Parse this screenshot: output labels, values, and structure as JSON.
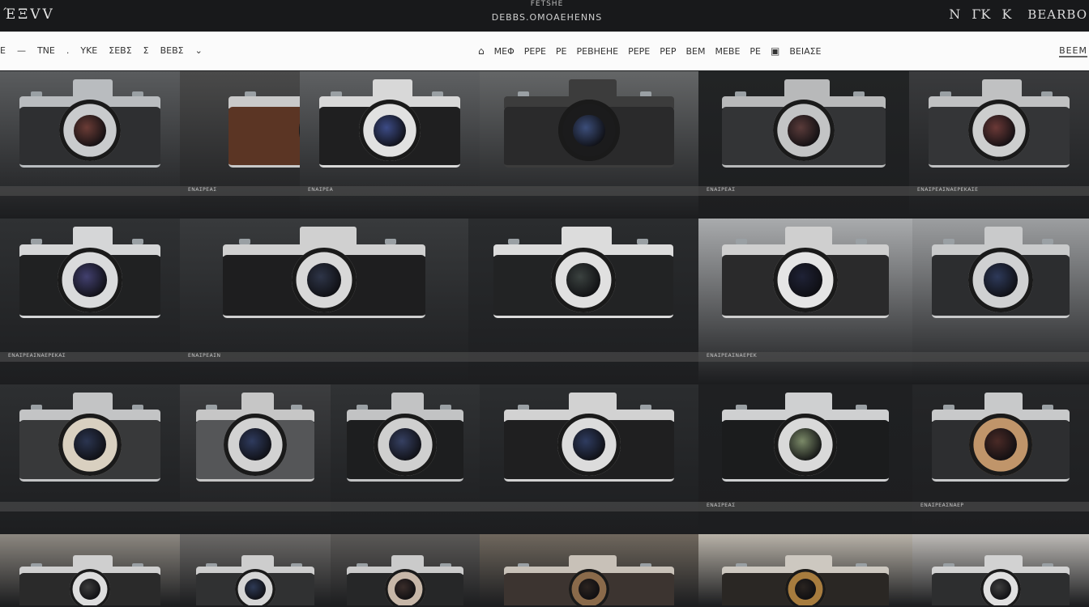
{
  "header": {
    "brand": "ΈΞVV",
    "title": "FETSHE",
    "subtitle": "DEBBS.OMOAEHENNS",
    "right_glyphs": [
      "Ν",
      "ΓΚ",
      "Κ"
    ],
    "account_label": "BEARBO"
  },
  "toolbar": {
    "nav": [
      "Ε",
      "—",
      "ΤΝΕ",
      ".",
      "ΥΚΕ",
      "ΣΕΒΣ",
      "Σ",
      "ΒΕΒΣ",
      "⌄"
    ],
    "mid_icon": "gift-icon",
    "mid_items": [
      "ΜΕΦ",
      "ΡΕΡΕ",
      "ΡΕ",
      "ΡΕΒΗΕΗΕ",
      "ΡΕΡΕ",
      "ΡΕΡ",
      "ΒΕΜ",
      "ΜΕΒΕ",
      "ΡΕ"
    ],
    "tag_icon": "tag-icon",
    "tag_label": "ΒΕΙΑΣΕ",
    "sort_label": "ΒΕΕΜ"
  },
  "grid": {
    "rows": [
      {
        "tiles": [
          {
            "caption": "",
            "bg": "#5a5c5e",
            "cam": {
              "body": "#2e2f31",
              "trim": "#b9bcbf",
              "lens": "#c9cbcd",
              "glass": "#6b3c36"
            }
          },
          {
            "caption": "ΕΝΑΣΡΕΑΣ",
            "bg": "#4a4a4a",
            "cam": {
              "body": "#5b3524",
              "trim": "#c9c9c9",
              "lens": "#2a2a2a",
              "glass": "#3a3a3a"
            }
          },
          {
            "caption": "ΕΝΑΣΡΕΑ",
            "bg": "#5f6163",
            "cam": {
              "body": "#1f1f20",
              "trim": "#d8d8d8",
              "lens": "#e1e1e1",
              "glass": "#3c4b86"
            }
          },
          {
            "caption": "",
            "bg": "#646667",
            "cam": {
              "body": "#2a2a2b",
              "trim": "#3c3c3c",
              "lens": "#1b1b1c",
              "glass": "#3c4e7a"
            }
          },
          {
            "caption": "ΕΝΑΣΡΕΑΣ",
            "bg": "#222425",
            "cam": {
              "body": "#333436",
              "trim": "#b8b9ba",
              "lens": "#c3c4c5",
              "glass": "#5a3b3a"
            }
          },
          {
            "caption": "ΕΝΑΣΡΕΑΣΝΑΕΡΕΚΑΣΕ",
            "bg": "#3a3b3d",
            "cam": {
              "body": "#343537",
              "trim": "#c0c1c2",
              "lens": "#cdcece",
              "glass": "#6b3937"
            }
          }
        ]
      },
      {
        "tiles": [
          {
            "caption": "ΕΝΑΣΡΕΑΣΝΑΕΡΕΚΑΣ",
            "bg": "#2f3133",
            "cam": {
              "body": "#202122",
              "trim": "#d5d6d7",
              "lens": "#dadbdc",
              "glass": "#42406f"
            }
          },
          {
            "caption": "ΕΝΑΣΡΕΑΣΝ",
            "bg": "#383a3c",
            "cam": {
              "body": "#1e1e1f",
              "trim": "#d0d0d0",
              "lens": "#d8d8d8",
              "glass": "#2e3548"
            }
          },
          {
            "caption": "",
            "bg": "#2a2c2e",
            "cam": {
              "body": "#222324",
              "trim": "#dcdcdc",
              "lens": "#e0e0e0",
              "glass": "#3b4240"
            }
          },
          {
            "caption": "ΕΝΑΣΡΕΑΣΝΑΕΡΕΚ",
            "bg": "#a9abad",
            "cam": {
              "body": "#2a2a2b",
              "trim": "#cfcfcf",
              "lens": "#e5e5e5",
              "glass": "#1f2236"
            }
          },
          {
            "caption": "",
            "bg": "#9c9ea0",
            "cam": {
              "body": "#2c2d2f",
              "trim": "#c9cacb",
              "lens": "#d0d1d2",
              "glass": "#2e3a5a"
            }
          }
        ]
      },
      {
        "tiles": [
          {
            "caption": "",
            "bg": "#2d2f31",
            "cam": {
              "body": "#38393a",
              "trim": "#c3c4c5",
              "lens": "#d9d0c0",
              "glass": "#2b3550"
            }
          },
          {
            "caption": "",
            "bg": "#3c3d3f",
            "cam": {
              "body": "#555658",
              "trim": "#c6c6c6",
              "lens": "#d2d2d2",
              "glass": "#2f3b5e"
            }
          },
          {
            "caption": "",
            "bg": "#303234",
            "cam": {
              "body": "#1d1e1f",
              "trim": "#c2c3c4",
              "lens": "#cfcfcf",
              "glass": "#364062"
            }
          },
          {
            "caption": "",
            "bg": "#2b2d2f",
            "cam": {
              "body": "#1f1f20",
              "trim": "#d2d2d2",
              "lens": "#dcdcdc",
              "glass": "#2f3c60"
            }
          },
          {
            "caption": "ΕΝΑΣΡΕΑΣ",
            "bg": "#1f2022",
            "cam": {
              "body": "#1b1c1d",
              "trim": "#cfd0d1",
              "lens": "#d9d9d9",
              "glass": "#7b8a68"
            }
          },
          {
            "caption": "ΕΝΑΣΡΕΑΣΝΑΕΡ",
            "bg": "#252628",
            "cam": {
              "body": "#2d2e30",
              "trim": "#c8c9ca",
              "lens": "#c0956a",
              "glass": "#4a2a26"
            }
          }
        ]
      },
      {
        "tiles": [
          {
            "caption": "",
            "bg": "#8c8780",
            "cam": {
              "body": "#2a2a2a",
              "trim": "#cfcfcf",
              "lens": "#dddddd",
              "glass": "#3c3c3c"
            }
          },
          {
            "caption": "",
            "bg": "#6a6866",
            "cam": {
              "body": "#303132",
              "trim": "#cdcdcd",
              "lens": "#d5d5d5",
              "glass": "#2e3a55"
            }
          },
          {
            "caption": "",
            "bg": "#5a5856",
            "cam": {
              "body": "#262728",
              "trim": "#cacaca",
              "lens": "#c7b7a8",
              "glass": "#3a2d2a"
            }
          },
          {
            "caption": "",
            "bg": "#6f675d",
            "cam": {
              "body": "#3c3430",
              "trim": "#c8c1b8",
              "lens": "#8a6a4a",
              "glass": "#2c2420"
            }
          },
          {
            "caption": "",
            "bg": "#b8b2a8",
            "cam": {
              "body": "#2a2724",
              "trim": "#cdc8c0",
              "lens": "#a77c3e",
              "glass": "#2a2420"
            }
          },
          {
            "caption": "",
            "bg": "#bdbab6",
            "cam": {
              "body": "#2d2e2f",
              "trim": "#d2d2d2",
              "lens": "#e0e0e0",
              "glass": "#3e3e3e"
            }
          }
        ]
      }
    ]
  }
}
